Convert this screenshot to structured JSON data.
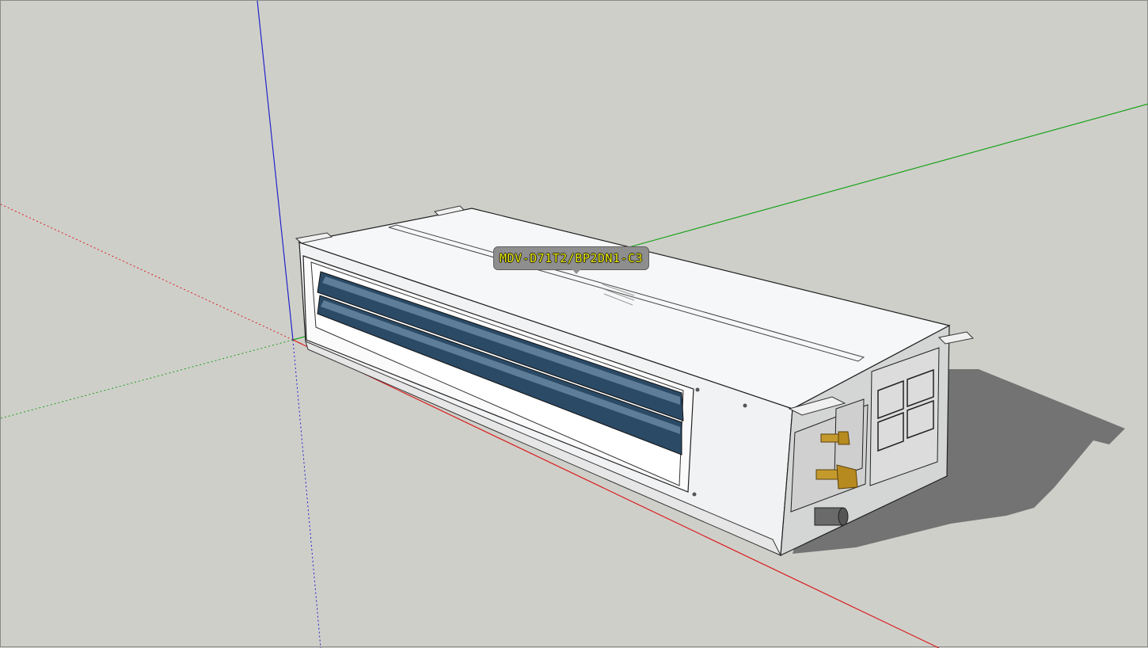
{
  "viewport": {
    "background": "#cfcfca",
    "axis_colors": {
      "red": "#d81f1f",
      "green": "#19a319",
      "blue": "#2323c8"
    }
  },
  "model": {
    "name": "ducted-ac-indoor-unit",
    "tooltip_text": "MDV-D71T2/BP2DN1-C3",
    "colors": {
      "casing": "#f4f6f7",
      "casing_side": "#ececec",
      "end_panel": "#cfd0d0",
      "louver": "#2b4a66",
      "brass": "#c49a2d",
      "shadow": "#6e6e6e"
    }
  }
}
